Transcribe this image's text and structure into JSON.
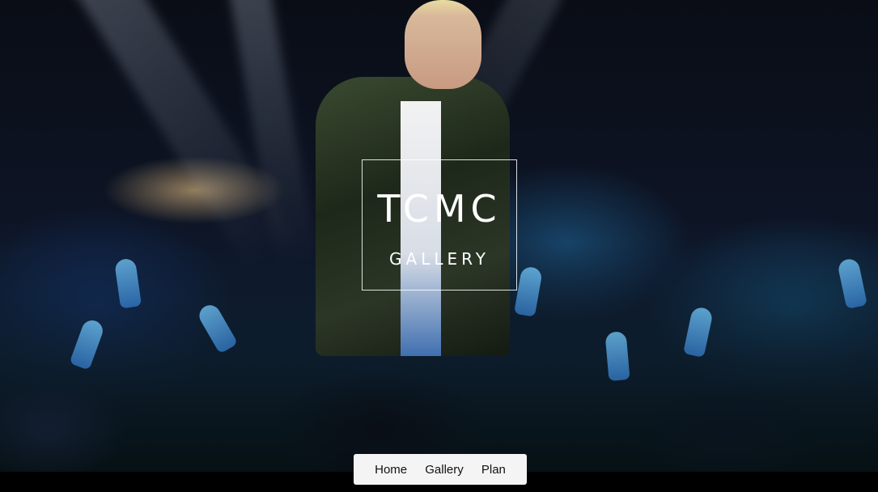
{
  "hero": {
    "title": "TCMC",
    "subtitle": "GALLERY"
  },
  "nav": {
    "items": [
      {
        "label": "Home"
      },
      {
        "label": "Gallery"
      },
      {
        "label": "Plan"
      }
    ]
  },
  "colors": {
    "nav_background": "#f4f4f4",
    "nav_text": "#111111",
    "title_text": "#ffffff",
    "page_background": "#000000"
  }
}
